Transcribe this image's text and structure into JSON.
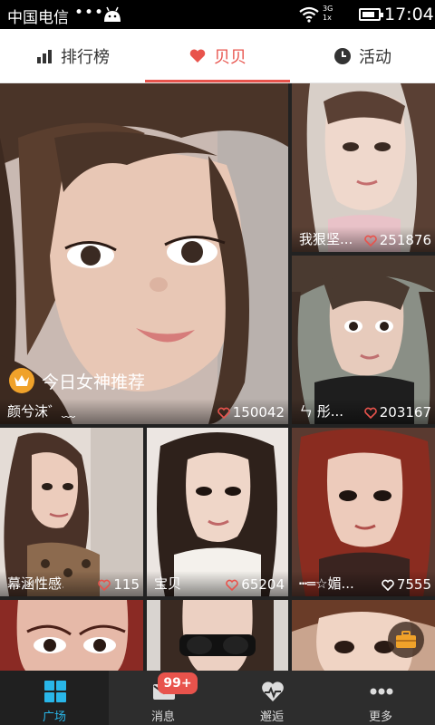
{
  "status_bar": {
    "carrier": "中国电信",
    "dots": "•••",
    "network_top": "3G",
    "network_bottom": "1x",
    "battery_level": 0.8,
    "time": "17:04"
  },
  "tabs": [
    {
      "label": "排行榜",
      "icon": "bar-chart-icon",
      "active": false
    },
    {
      "label": "贝贝",
      "icon": "heart-icon",
      "active": true
    },
    {
      "label": "活动",
      "icon": "clock-icon",
      "active": false
    }
  ],
  "feature": {
    "badge_text": "今日女神推荐",
    "name": "颜兮沫゛﹏",
    "likes": "150042"
  },
  "cards": [
    {
      "name": "我狠坚...",
      "likes": "251876"
    },
    {
      "name": "ㄣ  彤...",
      "likes": "203167"
    },
    {
      "name": "幕涵性感...",
      "likes": "115"
    },
    {
      "name": "宝贝",
      "likes": "65204"
    },
    {
      "name": "┅═☆媚...",
      "likes": "7555"
    }
  ],
  "bottom_nav": [
    {
      "label": "广场",
      "icon": "grid-icon",
      "active": true
    },
    {
      "label": "消息",
      "icon": "mail-icon",
      "active": false,
      "badge": "99+"
    },
    {
      "label": "邂逅",
      "icon": "pulse-heart-icon",
      "active": false
    },
    {
      "label": "更多",
      "icon": "more-dots-icon",
      "active": false
    }
  ],
  "colors": {
    "accent": "#e8534c",
    "nav_active": "#29b6e8",
    "crown": "#f0a22a"
  }
}
